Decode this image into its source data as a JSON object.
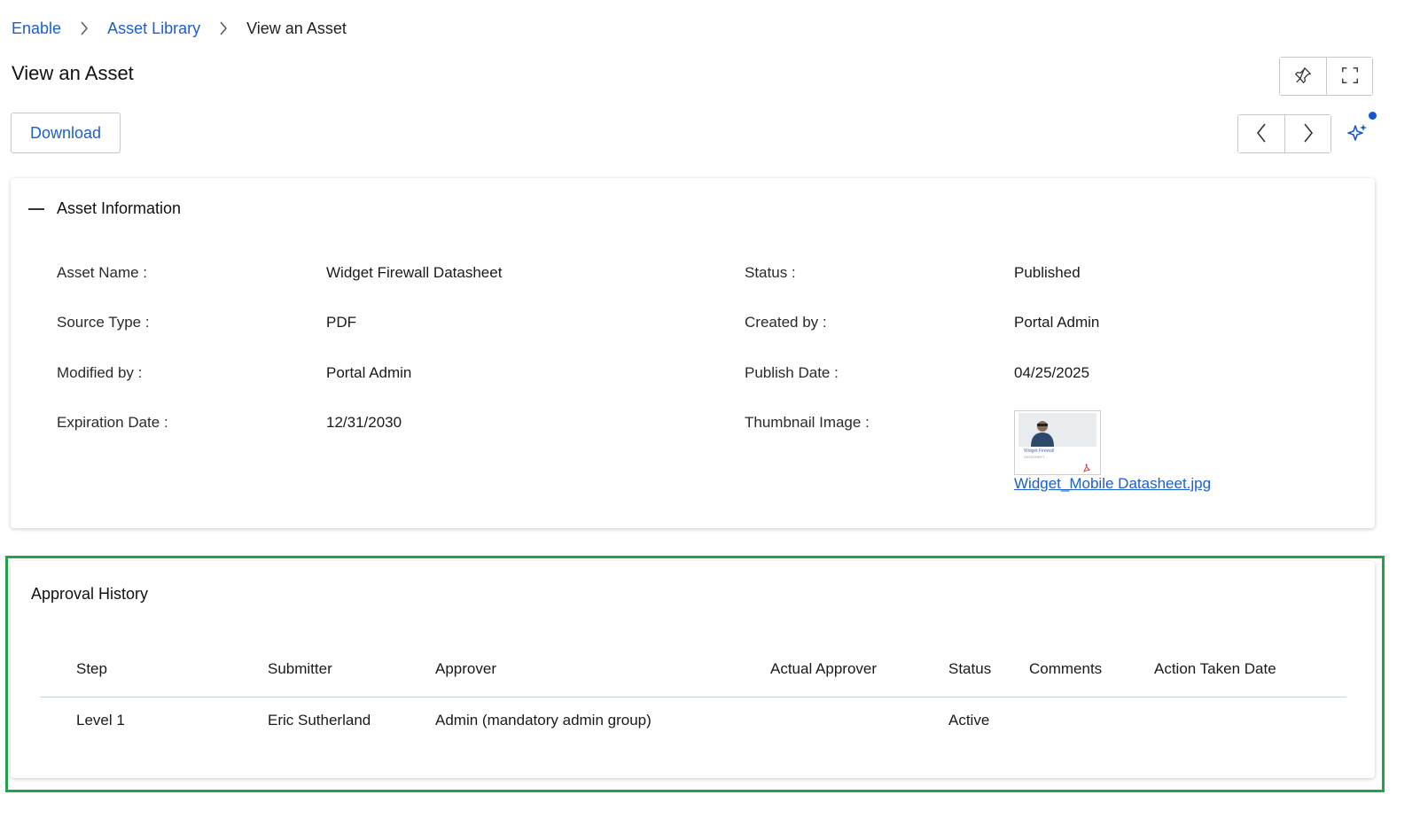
{
  "breadcrumb": {
    "items": [
      "Enable",
      "Asset Library"
    ],
    "current": "View an Asset"
  },
  "page": {
    "title": "View an Asset"
  },
  "toolbar": {
    "download_label": "Download"
  },
  "icons": {
    "pin": "pin-icon",
    "fullscreen": "expand-icon",
    "prev": "chevron-left-icon",
    "next": "chevron-right-icon",
    "ai": "sparkle-icon"
  },
  "colors": {
    "link": "#1a5fd1",
    "highlight": "#22a24a",
    "notification_dot": "#1456d4"
  },
  "asset_info": {
    "title": "Asset Information",
    "fields": {
      "asset_name": {
        "label": "Asset Name :",
        "value": "Widget Firewall Datasheet"
      },
      "source_type": {
        "label": "Source Type :",
        "value": "PDF"
      },
      "modified_by": {
        "label": "Modified by :",
        "value": "Portal Admin"
      },
      "expiration_date": {
        "label": "Expiration Date :",
        "value": "12/31/2030"
      },
      "status": {
        "label": "Status :",
        "value": "Published"
      },
      "created_by": {
        "label": "Created by :",
        "value": "Portal Admin"
      },
      "publish_date": {
        "label": "Publish Date :",
        "value": "04/25/2025"
      },
      "thumbnail": {
        "label": "Thumbnail Image :",
        "file_name": "Widget_Mobile Datasheet.jpg",
        "thumb_caption": "Widget Firewall",
        "thumb_sub": "DATASHEET"
      }
    }
  },
  "approval_history": {
    "title": "Approval History",
    "columns": [
      "Step",
      "Submitter",
      "Approver",
      "Actual Approver",
      "Status",
      "Comments",
      "Action Taken Date"
    ],
    "rows": [
      {
        "step": "Level 1",
        "submitter": "Eric Sutherland",
        "approver": "Admin (mandatory admin group)",
        "actual_approver": "",
        "status": "Active",
        "comments": "",
        "action_taken_date": ""
      }
    ]
  }
}
